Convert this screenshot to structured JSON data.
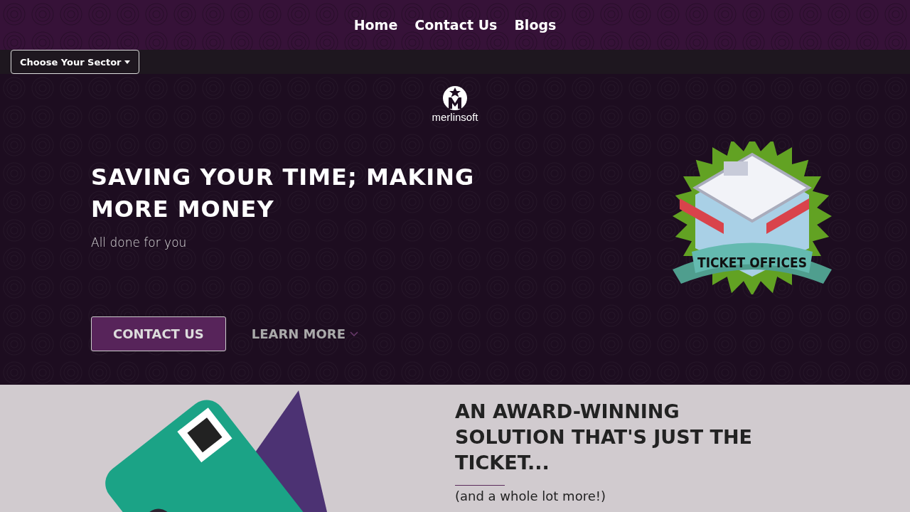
{
  "nav": {
    "links": [
      {
        "label": "Home"
      },
      {
        "label": "Contact Us"
      },
      {
        "label": "Blogs"
      }
    ]
  },
  "sector_menu": {
    "label": "Choose Your Sector",
    "expanded": false
  },
  "logo": {
    "name": "merlinsoft"
  },
  "hero": {
    "title": "SAVING YOUR TIME; MAKING MORE MONEY",
    "subtitle": "All done for you",
    "badge_label": "TICKET OFFICES",
    "buttons": [
      {
        "kind": "primary",
        "label": "CONTACT US"
      },
      {
        "kind": "link",
        "label": "LEARN MORE"
      }
    ]
  },
  "feature": {
    "title": "AN AWARD-WINNING SOLUTION THAT'S JUST THE TICKET...",
    "subtitle": "(and a whole lot more!)"
  }
}
